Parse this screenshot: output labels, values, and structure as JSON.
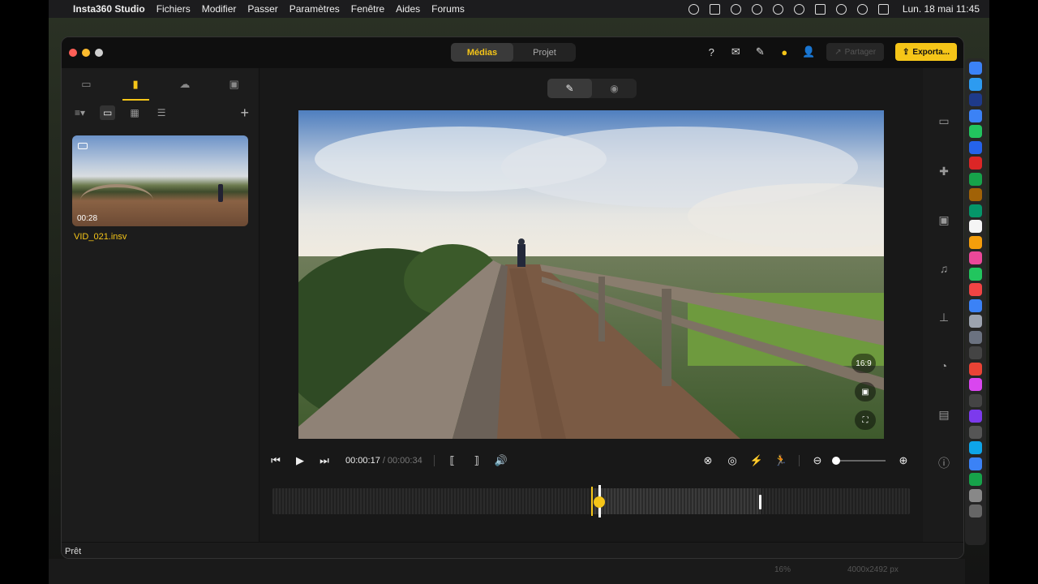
{
  "menubar": {
    "app_name": "Insta360 Studio",
    "items": [
      "Fichiers",
      "Modifier",
      "Passer",
      "Paramètres",
      "Fenêtre",
      "Aides",
      "Forums"
    ],
    "clock": "Lun. 18 mai  11:45"
  },
  "window": {
    "tabs": {
      "medias": "Médias",
      "projet": "Projet"
    },
    "share_label": "Partager",
    "export_label": "Exporta..."
  },
  "media": {
    "duration": "00:28",
    "filename": "VID_021.insv"
  },
  "player": {
    "time_current": "00:00:17",
    "time_separator": "/",
    "time_total": "00:00:34",
    "aspect_ratio": "16:9"
  },
  "status": {
    "text": "Prêt"
  },
  "background_app": {
    "zoom": "16%",
    "dimensions": "4000x2492 px"
  },
  "colors": {
    "accent": "#f5c518",
    "window_bg": "#1b1b1b"
  }
}
